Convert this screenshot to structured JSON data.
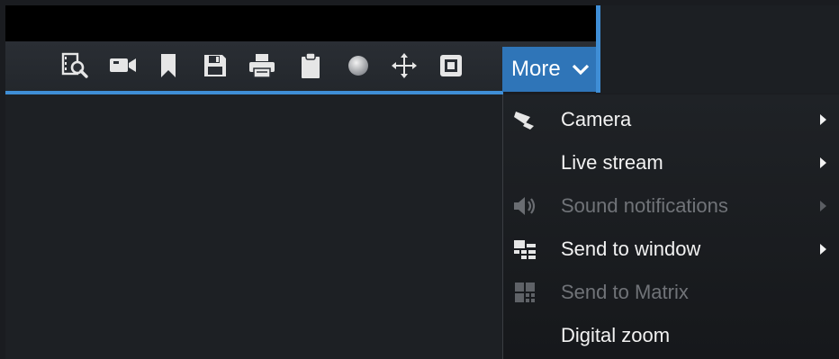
{
  "toolbar": {
    "buttons": [
      {
        "icon": "search-recording-icon"
      },
      {
        "icon": "camera-icon"
      },
      {
        "icon": "bookmark-icon"
      },
      {
        "icon": "save-icon"
      },
      {
        "icon": "print-icon"
      },
      {
        "icon": "clipboard-icon"
      },
      {
        "icon": "record-icon"
      },
      {
        "icon": "move-icon"
      },
      {
        "icon": "fullscreen-icon"
      }
    ],
    "more_label": "More"
  },
  "menu": {
    "items": [
      {
        "label": "Camera",
        "icon": "camera-pin-icon",
        "enabled": true,
        "submenu": true
      },
      {
        "label": "Live stream",
        "icon": "",
        "enabled": true,
        "submenu": true
      },
      {
        "label": "Sound notifications",
        "icon": "speaker-icon",
        "enabled": false,
        "submenu": true
      },
      {
        "label": "Send to window",
        "icon": "send-to-window-icon",
        "enabled": true,
        "submenu": true
      },
      {
        "label": "Send to Matrix",
        "icon": "matrix-icon",
        "enabled": false,
        "submenu": false
      },
      {
        "label": "Digital zoom",
        "icon": "",
        "enabled": true,
        "submenu": false
      }
    ]
  },
  "colors": {
    "accent": "#3f8ed6",
    "more_bg": "#2f75b8",
    "text": "#f2f2f2",
    "disabled": "#707378"
  }
}
